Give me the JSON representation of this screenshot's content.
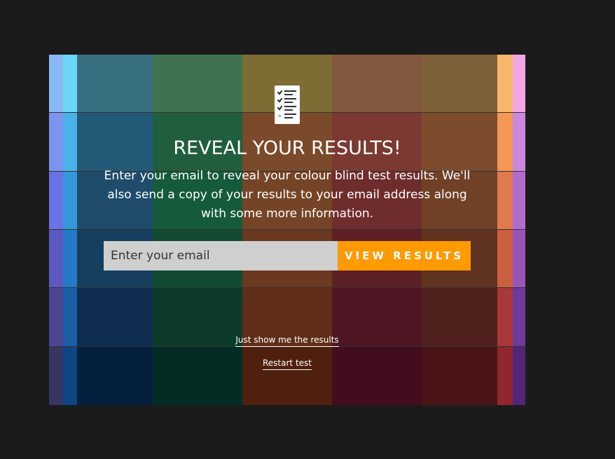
{
  "modal": {
    "title": "REVEAL YOUR RESULTS!",
    "description": "Enter your email to reveal your colour blind test results. We'll also send a copy of your results to your email address along with some more information.",
    "email_placeholder": "Enter your email",
    "submit_label": "VIEW RESULTS",
    "show_results_link": "Just show me the results",
    "restart_link": "Restart test",
    "icon": "checklist-icon"
  },
  "colors": {
    "page_background": "#1b1b1b",
    "accent": "#ff9a00",
    "input_background": "#cfcfcf",
    "rows": [
      [
        "#8ab8f4",
        "#6cd6f6",
        "#397081",
        "#3f724f",
        "#7d6d35",
        "#845740",
        "#7e6139",
        "#f7b86d",
        "#f3a6e4"
      ],
      [
        "#7c93f0",
        "#4ab2ea",
        "#245a77",
        "#215e3e",
        "#7b4a2a",
        "#7c3932",
        "#7d4c2c",
        "#f49757",
        "#cb88dc"
      ],
      [
        "#6a73e3",
        "#3697da",
        "#1f4c6b",
        "#155a3b",
        "#754427",
        "#6f2c2c",
        "#704127",
        "#e1794e",
        "#b06ccb"
      ],
      [
        "#5b58c2",
        "#2679c6",
        "#153e5f",
        "#124b34",
        "#6a3920",
        "#5d2024",
        "#5f3320",
        "#cb5f42",
        "#9a54b8"
      ],
      [
        "#4a4690",
        "#1a5ea5",
        "#0e2d50",
        "#0c3b2c",
        "#5f2d18",
        "#4e1623",
        "#4f201c",
        "#a9383a",
        "#6f3a9a"
      ],
      [
        "#383563",
        "#0f4582",
        "#04203e",
        "#042c25",
        "#50200f",
        "#440c1f",
        "#4a1417",
        "#8f2630",
        "#522577"
      ]
    ]
  }
}
